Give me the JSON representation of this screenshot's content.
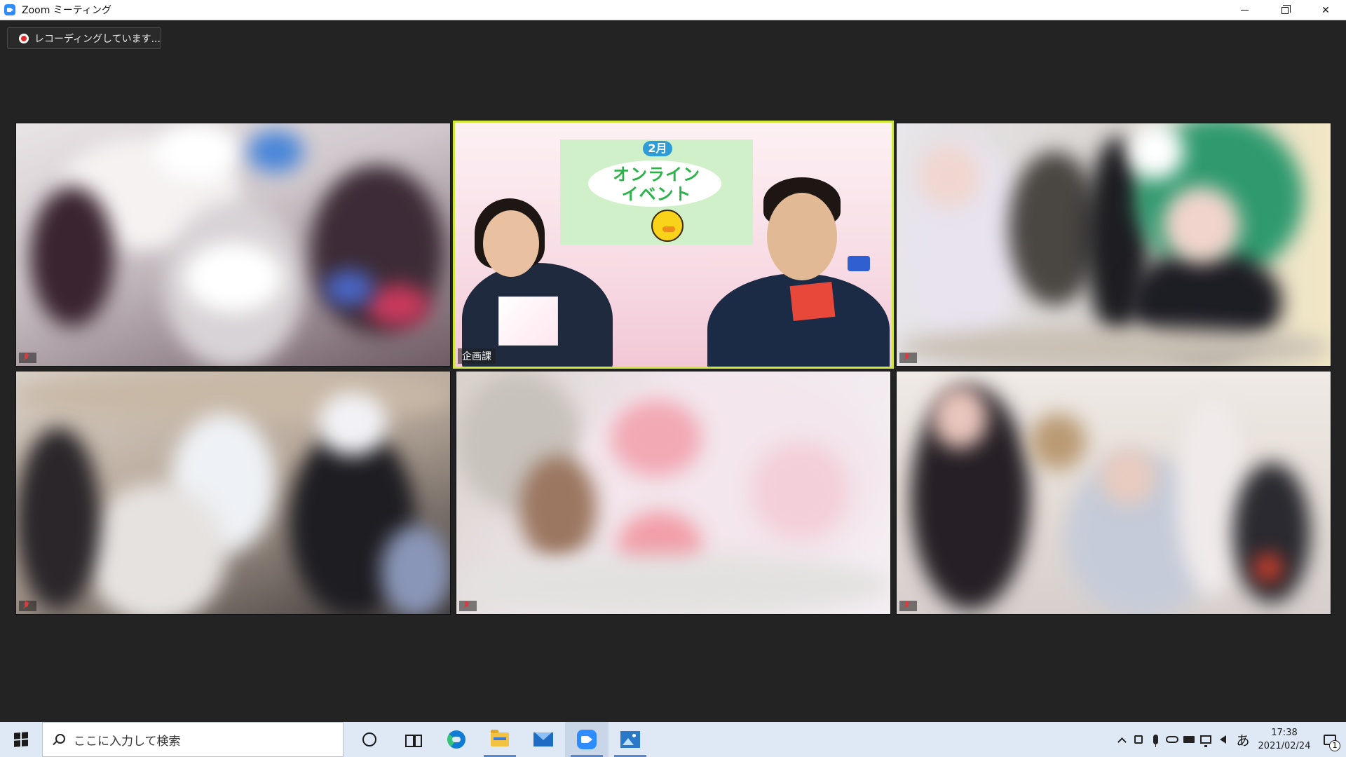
{
  "window": {
    "title": "Zoom ミーティング"
  },
  "recording": {
    "label": "レコーディングしています..."
  },
  "tiles": [
    {
      "id": "tile-1",
      "name": ""
    },
    {
      "id": "tile-2",
      "name": "企画課",
      "active": true
    },
    {
      "id": "tile-3",
      "name": ""
    },
    {
      "id": "tile-4",
      "name": ""
    },
    {
      "id": "tile-5",
      "name": ""
    },
    {
      "id": "tile-6",
      "name": ""
    }
  ],
  "banner": {
    "month": "2月",
    "line1": "オンライン",
    "line2": "イベント"
  },
  "taskbar": {
    "search_placeholder": "ここに入力して検索",
    "ime": "あ",
    "time": "17:38",
    "date": "2021/02/24",
    "notification_count": "1"
  },
  "colors": {
    "active_border": "#cfe93a",
    "zoom_blue": "#2d8cff",
    "recording_red": "#e02828"
  }
}
